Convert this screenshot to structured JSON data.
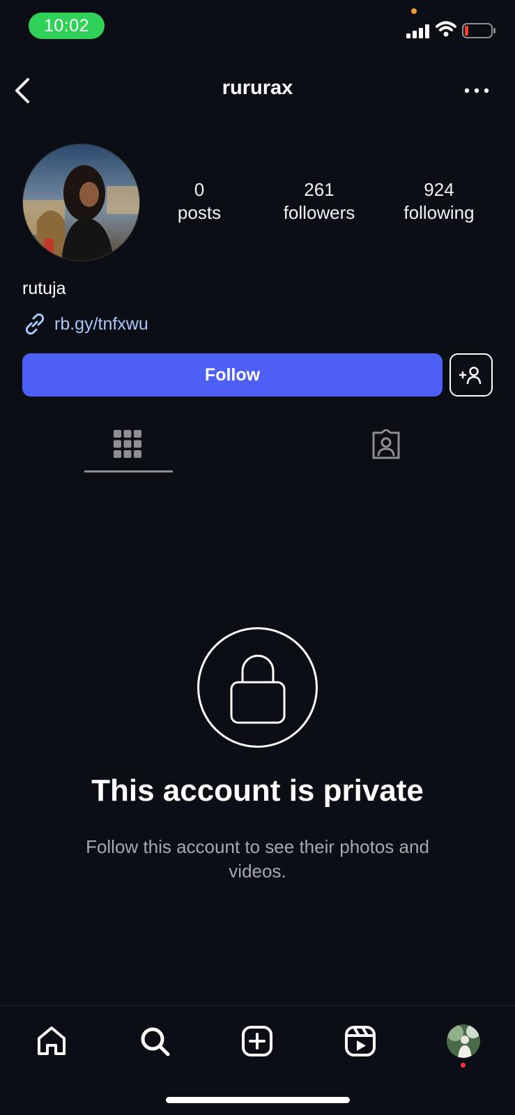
{
  "status_bar": {
    "time": "10:02"
  },
  "header": {
    "username": "rururax",
    "back_icon": "chevron-left-icon",
    "more_icon": "more-horizontal-icon"
  },
  "profile": {
    "stats": [
      {
        "value": "0",
        "label": "posts"
      },
      {
        "value": "261",
        "label": "followers"
      },
      {
        "value": "924",
        "label": "following"
      }
    ],
    "display_name": "rutuja",
    "link_text": "rb.gy/tnfxwu"
  },
  "actions": {
    "follow_label": "Follow",
    "suggest_icon": "add-person-icon"
  },
  "tabs": [
    {
      "name": "grid",
      "icon": "grid-icon",
      "selected": true
    },
    {
      "name": "tagged",
      "icon": "tagged-person-icon",
      "selected": false
    }
  ],
  "private_notice": {
    "title": "This account is private",
    "subtitle": "Follow this account to see their photos and videos."
  },
  "bottom_nav": [
    {
      "name": "home",
      "icon": "home-icon"
    },
    {
      "name": "search",
      "icon": "search-icon"
    },
    {
      "name": "create",
      "icon": "plus-square-icon"
    },
    {
      "name": "reels",
      "icon": "reels-icon"
    },
    {
      "name": "profile",
      "icon": "avatar"
    }
  ],
  "colors": {
    "background": "#0b0e14",
    "follow_button": "#4e5ff6",
    "link": "#a8c7fa",
    "time_pill": "#2fd158",
    "notification_dot": "#ff3040"
  }
}
